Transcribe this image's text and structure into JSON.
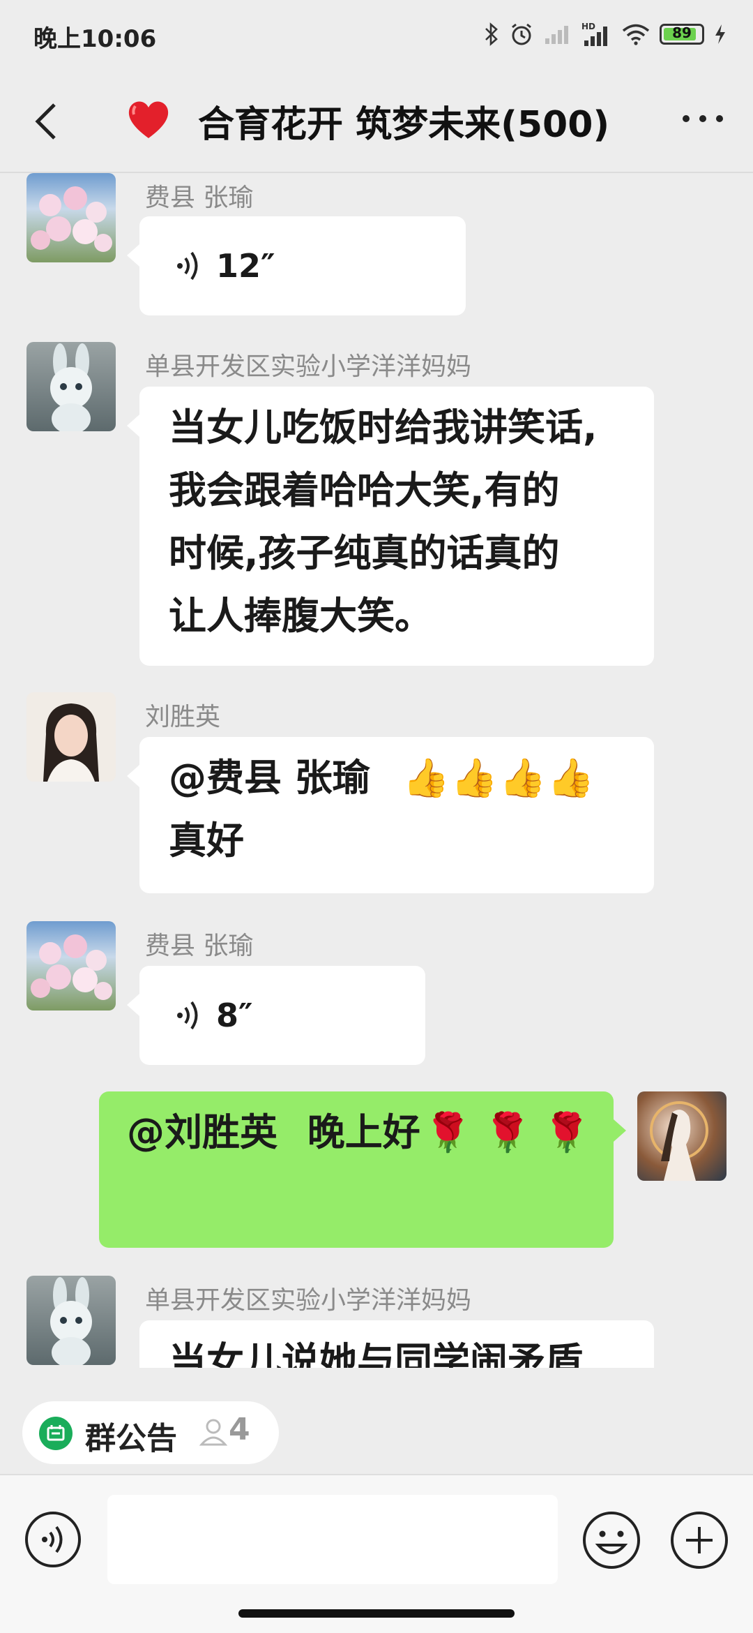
{
  "status_bar": {
    "time": "晚上10:06",
    "battery": "89"
  },
  "header": {
    "title": "合育花开 筑梦未来(500)"
  },
  "messages": [
    {
      "sender": "费县 张瑜",
      "type": "voice",
      "duration": "12″"
    },
    {
      "sender": "单县开发区实验小学洋洋妈妈",
      "type": "text",
      "lines": [
        "当女儿吃饭时给我讲笑话,",
        "我会跟着哈哈大笑,有的",
        "时候,孩子纯真的话真的",
        "让人捧腹大笑。"
      ]
    },
    {
      "sender": "刘胜英",
      "type": "text",
      "lines": [
        "@费县 张瑜 ",
        "真好"
      ],
      "emoji": "👍👍👍👍"
    },
    {
      "sender": "费县 张瑜",
      "type": "voice",
      "duration": "8″"
    },
    {
      "sender": "",
      "type": "text",
      "self": true,
      "lines": [
        "@刘胜英 晚上好"
      ],
      "emoji": "🌹🌹🌹"
    },
    {
      "sender": "单县开发区实验小学洋洋妈妈",
      "type": "text",
      "lines": [
        "当女儿说她与同学闹矛盾"
      ]
    }
  ],
  "notice": {
    "label": "群公告",
    "count": "4"
  },
  "input": {
    "value": ""
  },
  "colors": {
    "self_bubble": "#95ec69",
    "background": "#ededed"
  }
}
